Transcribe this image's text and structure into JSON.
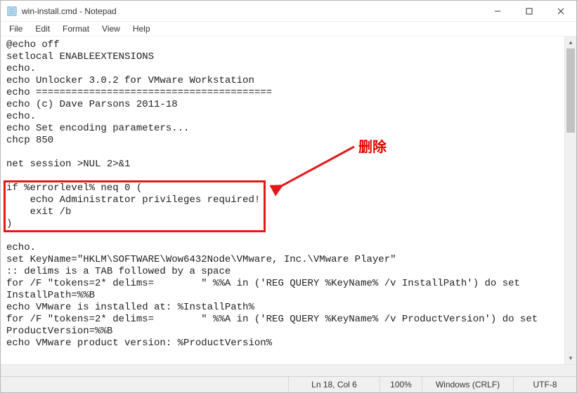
{
  "window": {
    "title": "win-install.cmd - Notepad",
    "icon_name": "notepad-icon"
  },
  "menu": {
    "file": "File",
    "edit": "Edit",
    "format": "Format",
    "view": "View",
    "help": "Help"
  },
  "editor": {
    "lines": [
      "@echo off",
      "setlocal ENABLEEXTENSIONS",
      "echo.",
      "echo Unlocker 3.0.2 for VMware Workstation",
      "echo ========================================",
      "echo (c) Dave Parsons 2011-18",
      "echo.",
      "echo Set encoding parameters...",
      "chcp 850",
      "",
      "net session >NUL 2>&1",
      "",
      "if %errorlevel% neq 0 (",
      "    echo Administrator privileges required!",
      "    exit /b",
      ")",
      "",
      "echo.",
      "set KeyName=\"HKLM\\SOFTWARE\\Wow6432Node\\VMware, Inc.\\VMware Player\"",
      ":: delims is a TAB followed by a space",
      "for /F \"tokens=2* delims=\t \" %%A in ('REG QUERY %KeyName% /v InstallPath') do set InstallPath=%%B",
      "echo VMware is installed at: %InstallPath%",
      "for /F \"tokens=2* delims=\t \" %%A in ('REG QUERY %KeyName% /v ProductVersion') do set ProductVersion=%%B",
      "echo VMware product version: %ProductVersion%"
    ]
  },
  "annotation": {
    "label": "删除"
  },
  "status": {
    "position": "Ln 18, Col 6",
    "zoom": "100%",
    "lineending": "Windows (CRLF)",
    "encoding": "UTF-8"
  }
}
